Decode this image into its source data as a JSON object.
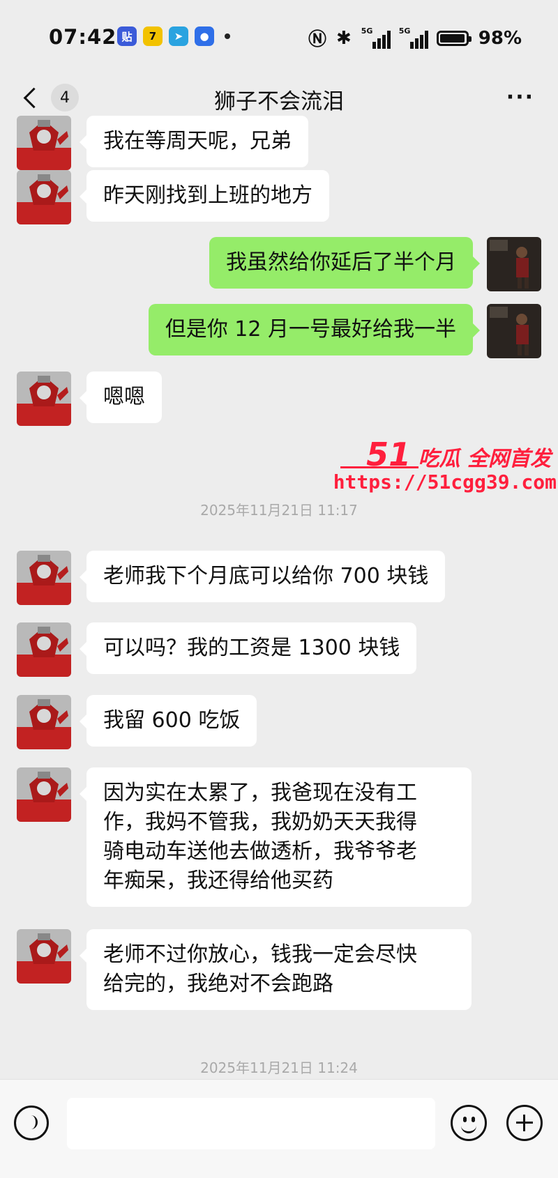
{
  "status_bar": {
    "time": "07:42",
    "app_icons": [
      {
        "icon": "tieba-icon",
        "glyph": "贴",
        "color": "#3b5bd9"
      },
      {
        "icon": "seven-app-icon",
        "glyph": "7",
        "color": "#f2c200"
      },
      {
        "icon": "telegram-icon",
        "glyph": "➤",
        "color": "#2aa3e0"
      },
      {
        "icon": "baidu-icon",
        "glyph": "●",
        "color": "#2f6fe8"
      }
    ],
    "signal_tag": "5G",
    "battery_level": 0.98,
    "battery": "98%"
  },
  "nav": {
    "unread_count": "4",
    "title": "狮子不会流泪",
    "more": "···"
  },
  "messages": [
    {
      "dir": "in",
      "text": "我在等周天呢，兄弟"
    },
    {
      "dir": "in",
      "text": "昨天刚找到上班的地方"
    },
    {
      "dir": "out",
      "text": "我虽然给你延后了半个月"
    },
    {
      "dir": "out",
      "text": "但是你 12 月一号最好给我一半"
    },
    {
      "dir": "in",
      "text": "嗯嗯"
    },
    {
      "dir": "in",
      "text": "老师我下个月底可以给你 700 块钱"
    },
    {
      "dir": "in",
      "text": "可以吗？我的工资是 1300 块钱"
    },
    {
      "dir": "in",
      "text": "我留 600 吃饭"
    },
    {
      "dir": "in",
      "lines": [
        "因为实在太累了，我爸现在没有工",
        "作，我妈不管我，我奶奶天天我得",
        "骑电动车送他去做透析，我爷爷老",
        "年痴呆，我还得给他买药"
      ]
    },
    {
      "dir": "in",
      "lines": [
        "老师不过你放心，钱我一定会尽快",
        "给完的，我绝对不会跑路"
      ]
    }
  ],
  "timestamps": [
    "2025年11月21日 11:17",
    "2025年11月21日 11:24"
  ],
  "watermark": {
    "number": "51",
    "slogan": "吃瓜 全网首发",
    "url": "https://51cgg39.com"
  },
  "input_bar": {
    "placeholder": ""
  },
  "colors": {
    "background": "#ededed",
    "bubble_in": "#ffffff",
    "bubble_out": "#95ec69",
    "watermark": "#ff1f3d"
  }
}
